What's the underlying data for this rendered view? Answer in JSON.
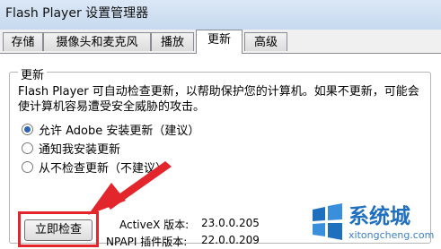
{
  "window": {
    "title": "Flash Player 设置管理器"
  },
  "tabs": [
    {
      "label": "存储"
    },
    {
      "label": "摄像头和麦克风"
    },
    {
      "label": "播放"
    },
    {
      "label": "更新"
    },
    {
      "label": "高级"
    }
  ],
  "active_tab": "更新",
  "update_group": {
    "title": "更新",
    "description": "Flash Player 可自动检查更新，以帮助保护您的计算机。如果不更新，可能会使计算机容易遭受安全威胁的攻击。",
    "options": [
      {
        "label": "允许 Adobe 安装更新（建议）",
        "selected": true
      },
      {
        "label": "通知我安装更新",
        "selected": false
      },
      {
        "label": "从不检查更新（不建议）",
        "selected": false
      }
    ],
    "check_button": "立即检查"
  },
  "versions": {
    "activex_label": "ActiveX 版本:",
    "activex_value": "23.0.0.205",
    "npapi_label": "NPAPI 插件版本:",
    "npapi_value": "22.0.0.209"
  },
  "watermark": {
    "name": "系统城",
    "url": "xitongcheng.com"
  },
  "colors": {
    "highlight": "#e3262b",
    "accent": "#2d64b8",
    "watermark": "#1f6fbf"
  }
}
